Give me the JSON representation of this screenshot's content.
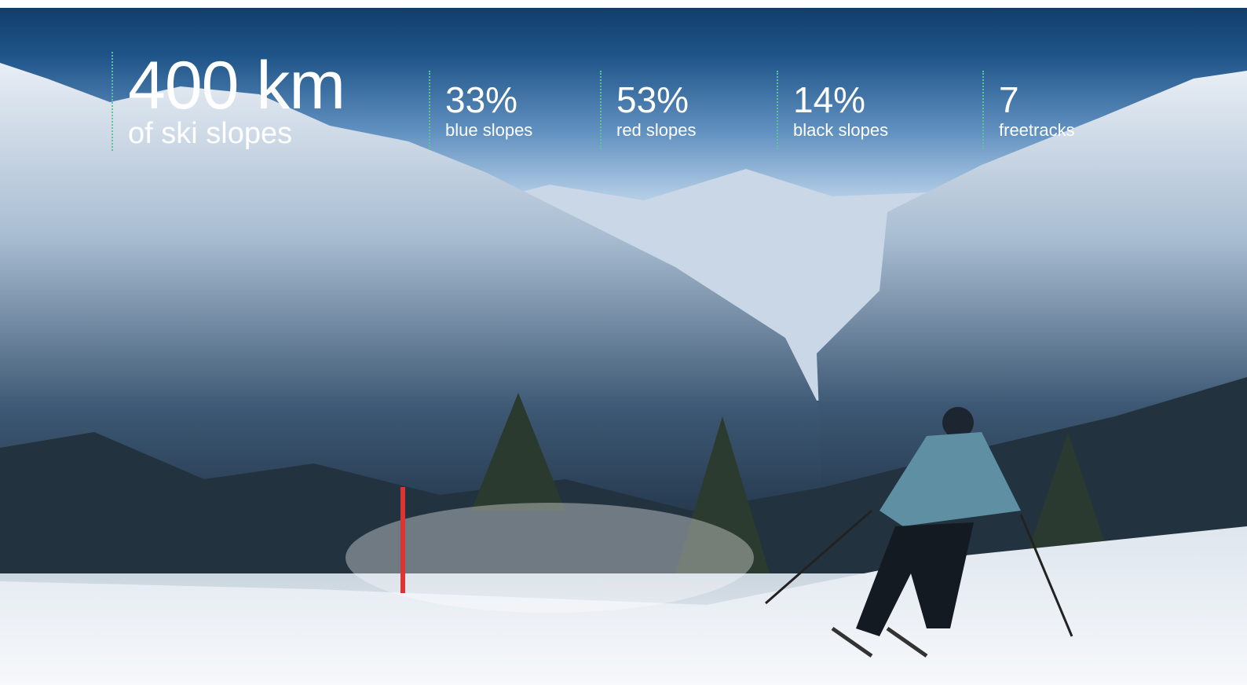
{
  "hero": {
    "image_description_icon": "mountain-skier-photo",
    "headline": {
      "value": "400 km",
      "label": "of ski slopes"
    },
    "stats": [
      {
        "value": "33%",
        "label": "blue slopes"
      },
      {
        "value": "53%",
        "label": "red slopes"
      },
      {
        "value": "14%",
        "label": "black slopes"
      },
      {
        "value": "7",
        "label": "freetracks"
      }
    ]
  },
  "colors": {
    "accent": "#57c79a",
    "text": "#ffffff",
    "sky": "#1f5488",
    "snow": "#eef2f6"
  }
}
